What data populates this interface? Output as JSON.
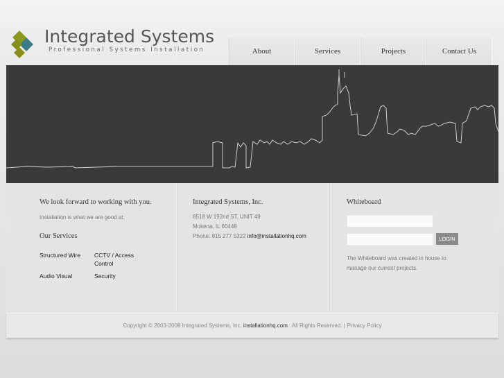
{
  "header": {
    "logo_title": "Integrated Systems",
    "logo_subtitle": "Professional Systems Installation",
    "logo_colors": {
      "top": "#8c9a1c",
      "middle": "#3c7c86",
      "left": "#858f1a",
      "bottom": "#8a8d18"
    }
  },
  "nav": {
    "items": [
      {
        "label": "About"
      },
      {
        "label": "Services"
      },
      {
        "label": "Projects"
      },
      {
        "label": "Contact Us"
      }
    ]
  },
  "main": {
    "col1": {
      "heading": "We look forward to working with you.",
      "tagline": "Installation is what we are good at.",
      "services_heading": "Our Services",
      "services": [
        "Structured Wire",
        "CCTV / Access Control",
        "Audio Visual",
        "Security"
      ]
    },
    "col2": {
      "company": "Integrated Systems, Inc.",
      "address1": "8518 W 192nd ST, UNIT 49",
      "address2": "Mokena, IL 60448",
      "phone": "Phone: 815 277 5322",
      "email": "info@installationhq.com"
    },
    "col3": {
      "heading": "Whiteboard",
      "username_value": "",
      "password_value": "",
      "login_label": "LOGIN",
      "description": "The Whiteboard was created in house to manage our current projects."
    }
  },
  "footer": {
    "copyright": "Copyright © 2003-2008 Integrated Systems, Inc.",
    "site": "installationhq.com",
    "rights": ". All Rights Reserved. |",
    "privacy": "Privacy Policy"
  }
}
